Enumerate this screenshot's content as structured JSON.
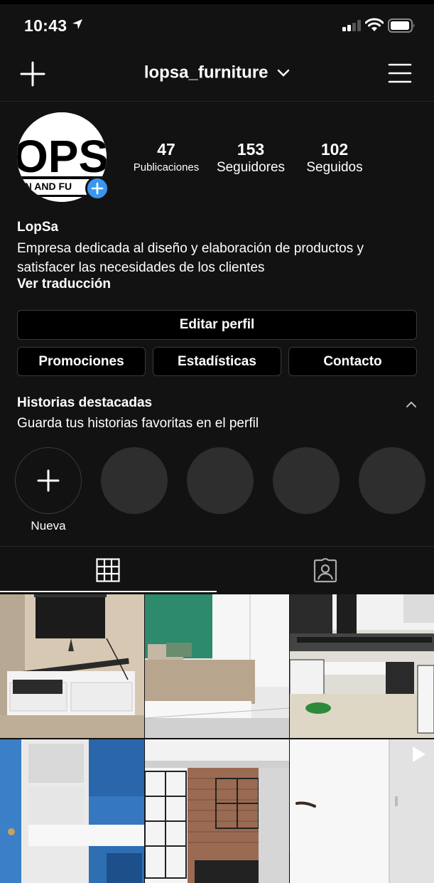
{
  "status_bar": {
    "time": "10:43"
  },
  "header": {
    "username": "lopsa_furniture"
  },
  "avatar": {
    "logo_text": "OPS",
    "logo_subtext": "IGN AND FU"
  },
  "stats": [
    {
      "value": "47",
      "label": "Publicaciones"
    },
    {
      "value": "153",
      "label": "Seguidores"
    },
    {
      "value": "102",
      "label": "Seguidos"
    }
  ],
  "profile": {
    "name": "LopSa",
    "bio_line1": "Empresa dedicada al diseño y elaboración de productos y",
    "bio_line2": "satisfacer las necesidades de los clientes",
    "translate_label": "Ver traducción"
  },
  "buttons": {
    "edit_profile": "Editar perfil",
    "promotions": "Promociones",
    "insights": "Estadísticas",
    "contact": "Contacto"
  },
  "highlights": {
    "title": "Historias destacadas",
    "subtitle": "Guarda tus historias favoritas en el perfil",
    "new_label": "Nueva"
  },
  "tabs": [
    {
      "icon": "grid-icon",
      "active": true
    },
    {
      "icon": "tagged-icon",
      "active": false
    }
  ],
  "colors": {
    "background": "#121212",
    "accent": "#3897f0",
    "border": "#3a3a3a"
  }
}
